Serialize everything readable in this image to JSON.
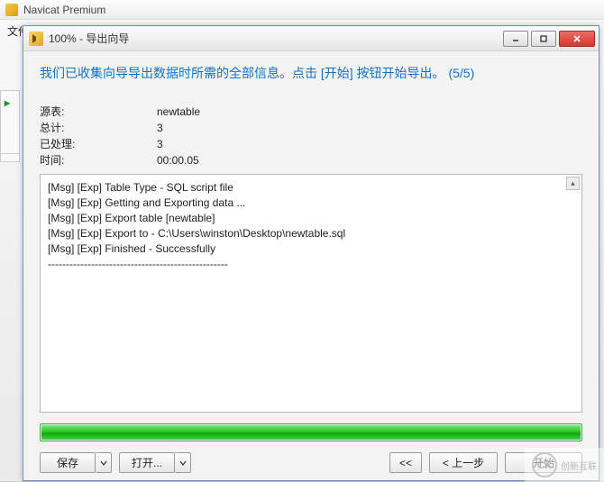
{
  "main_window": {
    "title": "Navicat Premium",
    "menu_file": "文件"
  },
  "dialog": {
    "title": "100% - 导出向导",
    "heading": "我们已收集向导导出数据时所需的全部信息。点击 [开始] 按钮开始导出。 (5/5)",
    "stats": {
      "source_label": "源表:",
      "source_value": "newtable",
      "total_label": "总计:",
      "total_value": "3",
      "processed_label": "已处理:",
      "processed_value": "3",
      "time_label": "时间:",
      "time_value": "00:00.05"
    },
    "log": [
      "[Msg] [Exp] Table Type - SQL script file",
      "[Msg] [Exp] Getting and Exporting data ...",
      "[Msg] [Exp] Export table [newtable]",
      "[Msg] [Exp] Export to - C:\\Users\\winston\\Desktop\\newtable.sql",
      "[Msg] [Exp] Finished - Successfully",
      "--------------------------------------------------"
    ],
    "progress_percent": 100,
    "buttons": {
      "save": "保存",
      "open": "打开...",
      "first": "<<",
      "prev": "< 上一步",
      "start": "开始"
    }
  },
  "watermark": {
    "brand_cn": "创新互联",
    "brand_abbr": "CX"
  }
}
